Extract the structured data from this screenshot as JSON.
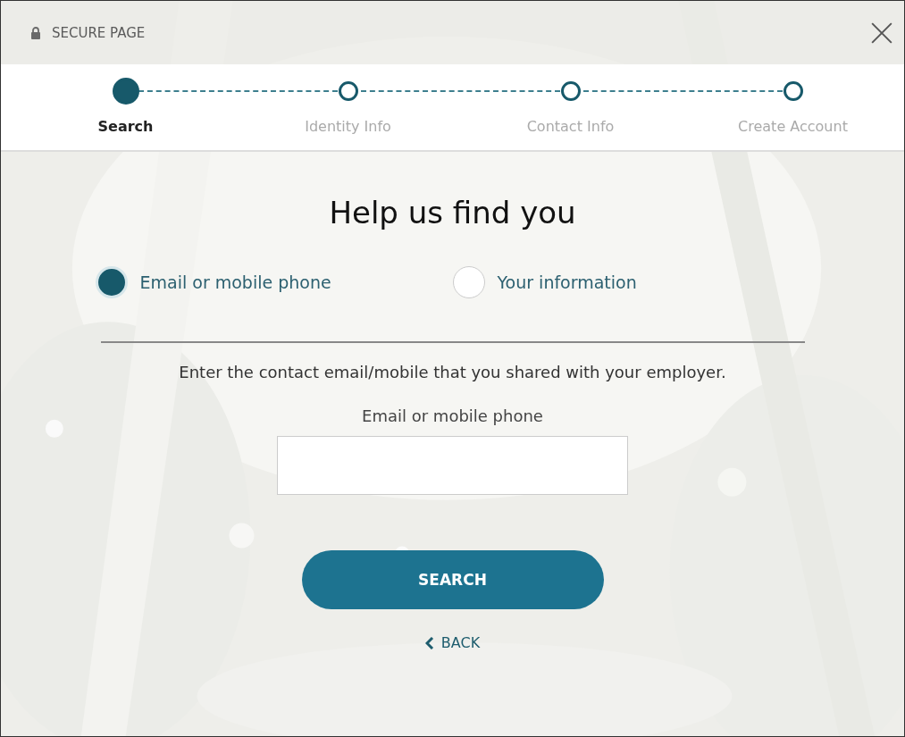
{
  "header": {
    "title": "SECURE PAGE"
  },
  "steps": [
    {
      "label": "Search",
      "selected": true
    },
    {
      "label": "Identity Info",
      "selected": false
    },
    {
      "label": "Contact Info",
      "selected": false
    },
    {
      "label": "Create Account",
      "selected": false
    }
  ],
  "heading": "Help us find you",
  "options": [
    {
      "label": "Email or mobile phone",
      "selected": true
    },
    {
      "label": "Your information",
      "selected": false
    }
  ],
  "instruction": "Enter the contact email/mobile that you shared with your employer.",
  "field": {
    "label": "Email or mobile phone"
  },
  "search_button": "SEARCH",
  "back_link": "BACK"
}
